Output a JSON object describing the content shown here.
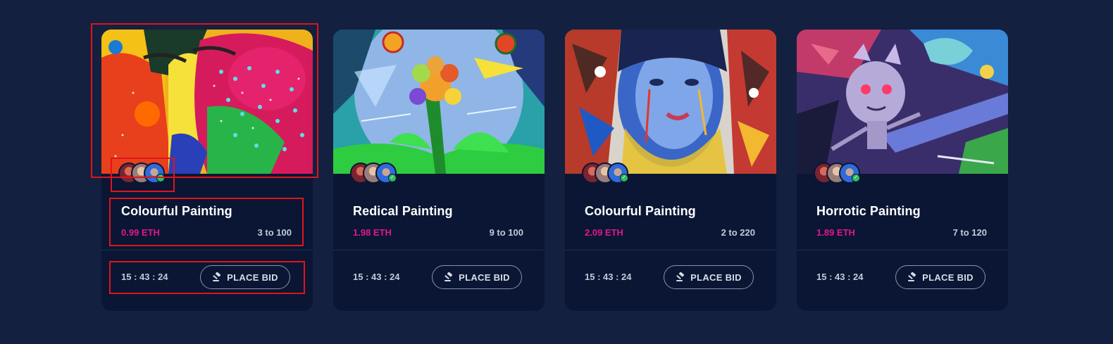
{
  "cards": [
    {
      "image": "colourful-face-painting",
      "title": "Colourful Painting",
      "price": "0.99 ETH",
      "range": "3 to 100",
      "timer": "15 : 43 : 24",
      "bid_label": "PLACE BID"
    },
    {
      "image": "flower-abstract-painting",
      "title": "Redical Painting",
      "price": "1.98 ETH",
      "range": "9 to 100",
      "timer": "15 : 43 : 24",
      "bid_label": "PLACE BID"
    },
    {
      "image": "woman-portrait-painting",
      "title": "Colourful Painting",
      "price": "2.09 ETH",
      "range": "2 to 220",
      "timer": "15 : 43 : 24",
      "bid_label": "PLACE BID"
    },
    {
      "image": "monster-abstract-painting",
      "title": "Horrotic Painting",
      "price": "1.89 ETH",
      "range": "7 to 120",
      "timer": "15 : 43 : 24",
      "bid_label": "PLACE BID"
    }
  ],
  "colors": {
    "background": "#13203f",
    "card": "#0a1634",
    "price": "#e3168a",
    "highlight": "#e0141c"
  },
  "icons": {
    "bid": "gavel-icon",
    "verified": "check-badge-icon"
  }
}
